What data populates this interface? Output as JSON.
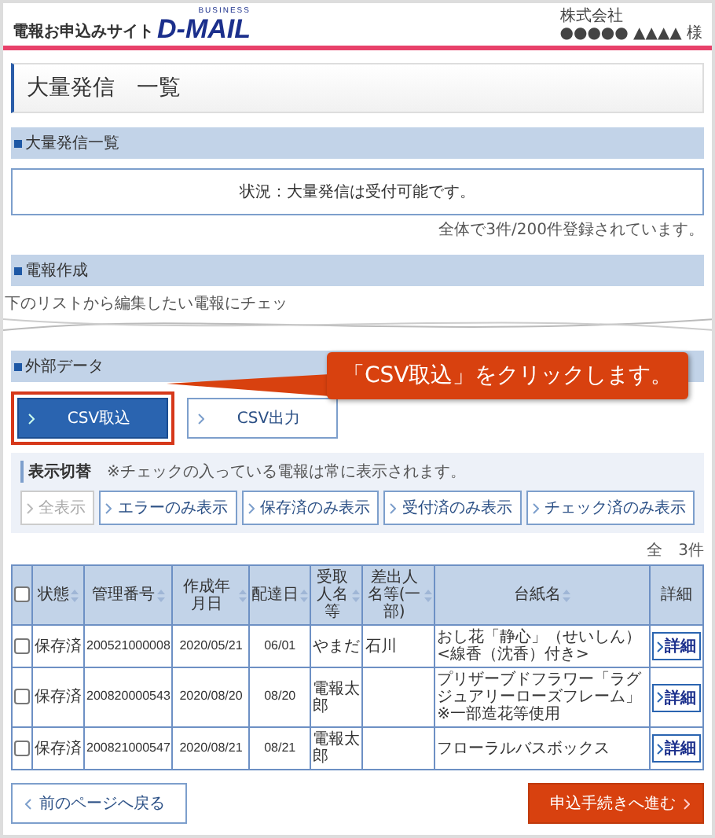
{
  "header": {
    "site_label": "電報お申込みサイト",
    "logo": "D-MAIL",
    "logo_tag": "BUSINESS",
    "company": "株式会社",
    "user": "●●●●● ▲▲▲▲ 様"
  },
  "page_title": "大量発信　一覧",
  "sections": [
    {
      "title": "大量発信一覧"
    },
    {
      "title": "電報作成"
    },
    {
      "title": "外部データ"
    }
  ],
  "status_message": "状況：大量発信は受付可能です。",
  "registered_note": "全体で3件/200件登録されています。",
  "editing_hint": "下のリストから編集したい電報にチェッ",
  "data_buttons": [
    {
      "label": "CSV取込",
      "kind": "primary",
      "highlighted": true
    },
    {
      "label": "CSV出力",
      "kind": "secondary",
      "highlighted": false
    }
  ],
  "callout": "「CSV取込」をクリックします。",
  "filter": {
    "title": "表示切替",
    "note": "※チェックの入っている電報は常に表示されます。",
    "buttons": [
      {
        "label": "全表示",
        "disabled": true
      },
      {
        "label": "エラーのみ表示",
        "disabled": false
      },
      {
        "label": "保存済のみ表示",
        "disabled": false
      },
      {
        "label": "受付済のみ表示",
        "disabled": false
      },
      {
        "label": "チェック済のみ表示",
        "disabled": false
      }
    ]
  },
  "table": {
    "count": "全　3件",
    "select_all_checked": false,
    "columns": [
      {
        "label": "状態",
        "sortable": true
      },
      {
        "label": "管理番号",
        "sortable": true
      },
      {
        "label": "作成年月日",
        "sortable": true
      },
      {
        "label": "配達日",
        "sortable": true
      },
      {
        "label": "受取人名等",
        "sortable": true
      },
      {
        "label": "差出人名等(一部)",
        "sortable": true
      },
      {
        "label": "台紙名",
        "sortable": true
      },
      {
        "label": "詳細",
        "sortable": false
      }
    ],
    "rows": [
      {
        "checked": false,
        "cells": [
          "保存済",
          "200521000008",
          "2020/05/21",
          "06/01",
          "やまだ",
          "石川",
          "おし花「静心」（せいしん）<線香（沈香）付き>"
        ],
        "detail": "詳細"
      },
      {
        "checked": false,
        "cells": [
          "保存済",
          "200820000543",
          "2020/08/20",
          "08/20",
          "電報太郎",
          "",
          "プリザーブドフラワー「ラグジュアリーローズフレーム」※一部造花等使用"
        ],
        "detail": "詳細"
      },
      {
        "checked": false,
        "cells": [
          "保存済",
          "200821000547",
          "2020/08/21",
          "08/21",
          "電報太郎",
          "",
          "フローラルバスボックス"
        ],
        "detail": "詳細"
      }
    ]
  },
  "nav": [
    {
      "label": "前のページへ戻る",
      "kind": "back"
    },
    {
      "label": "申込手続きへ進む",
      "kind": "next"
    }
  ]
}
